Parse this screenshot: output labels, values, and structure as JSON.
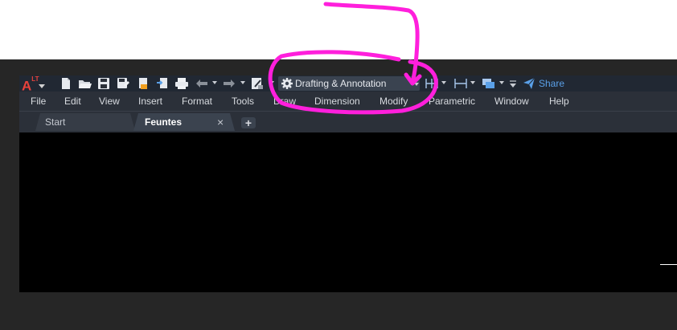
{
  "app": {
    "logo_letter": "A",
    "logo_sup": "LT",
    "brand_color": "#e8423b",
    "accent_color": "#5aa0e8",
    "annotation_color": "#ff1fdc"
  },
  "quick_access": {
    "icons": [
      "new-icon",
      "open-icon",
      "save-icon",
      "save-as-icon",
      "open-from-web-icon",
      "save-to-web-icon",
      "plot-icon",
      "undo-icon",
      "redo-icon",
      "match-properties-icon"
    ],
    "workspace": "Drafting & Annotation",
    "share_label": "Share"
  },
  "menu": {
    "items": [
      "File",
      "Edit",
      "View",
      "Insert",
      "Format",
      "Tools",
      "Draw",
      "Dimension",
      "Modify",
      "Parametric",
      "Window",
      "Help"
    ]
  },
  "tabs": {
    "start": "Start",
    "active": "Feuntes",
    "close_glyph": "×",
    "add_glyph": "+"
  }
}
